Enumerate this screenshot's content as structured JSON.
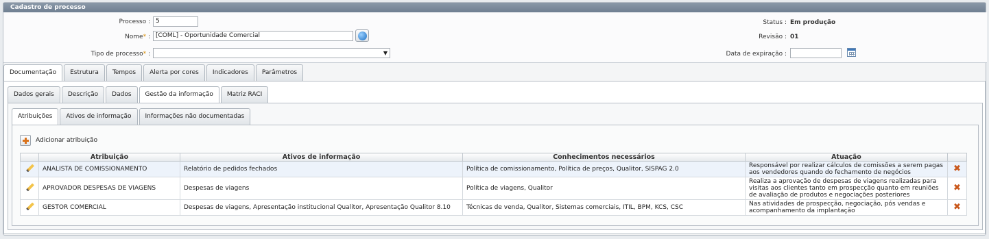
{
  "panel": {
    "title": "Cadastro de processo"
  },
  "form": {
    "processo_label": "Processo :",
    "processo_value": "5",
    "nome_label": "Nome",
    "nome_required": "*",
    "nome_colon": " :",
    "nome_value": "[COML] - Oportunidade Comercial",
    "tipo_label": "Tipo de processo",
    "tipo_required": "*",
    "tipo_colon": " :",
    "tipo_value": "",
    "status_label": "Status :",
    "status_value": "Em produção",
    "revisao_label": "Revisão :",
    "revisao_value": "01",
    "expiracao_label": "Data de expiração :",
    "expiracao_value": ""
  },
  "tabs_main": [
    "Documentação",
    "Estrutura",
    "Tempos",
    "Alerta por cores",
    "Indicadores",
    "Parâmetros"
  ],
  "tabs_doc": [
    "Dados gerais",
    "Descrição",
    "Dados",
    "Gestão da informação",
    "Matriz RACI"
  ],
  "tabs_info": [
    "Atribuições",
    "Ativos de informação",
    "Informações não documentadas"
  ],
  "toolbar": {
    "add_label": "Adicionar atribuição"
  },
  "table": {
    "headers": [
      "Atribuição",
      "Ativos de informação",
      "Conhecimentos necessários",
      "Atuação"
    ],
    "rows": [
      {
        "atribuicao": "ANALISTA DE COMISSIONAMENTO",
        "ativos": "Relatório de pedidos fechados",
        "conhecimentos": "Política de comissionamento, Política de preços, Qualitor, SISPAG 2.0",
        "atuacao": "Responsável por realizar cálculos de comissões a serem pagas aos vendedores quando do fechamento de negócios"
      },
      {
        "atribuicao": "APROVADOR DESPESAS DE VIAGENS",
        "ativos": "Despesas de viagens",
        "conhecimentos": "Política de viagens, Qualitor",
        "atuacao": "Realiza a aprovação de despesas de viagens realizadas para visitas aos clientes tanto em prospecção quanto em reuniões de avaliação de produtos e negociações posteriores"
      },
      {
        "atribuicao": "GESTOR COMERCIAL",
        "ativos": "Despesas de viagens, Apresentação institucional Qualitor, Apresentação Qualitor 8.10",
        "conhecimentos": "Técnicas de venda, Qualitor, Sistemas comerciais, ITIL, BPM, KCS, CSC",
        "atuacao": "Nas atividades de prospecção, negociação, pós vendas e acompanhamento da implantação"
      }
    ]
  },
  "icons": {
    "edit": "pencil-icon",
    "delete": "delete-x-icon",
    "add": "add-plus-icon",
    "globe": "globe-icon",
    "calendar": "calendar-icon"
  }
}
